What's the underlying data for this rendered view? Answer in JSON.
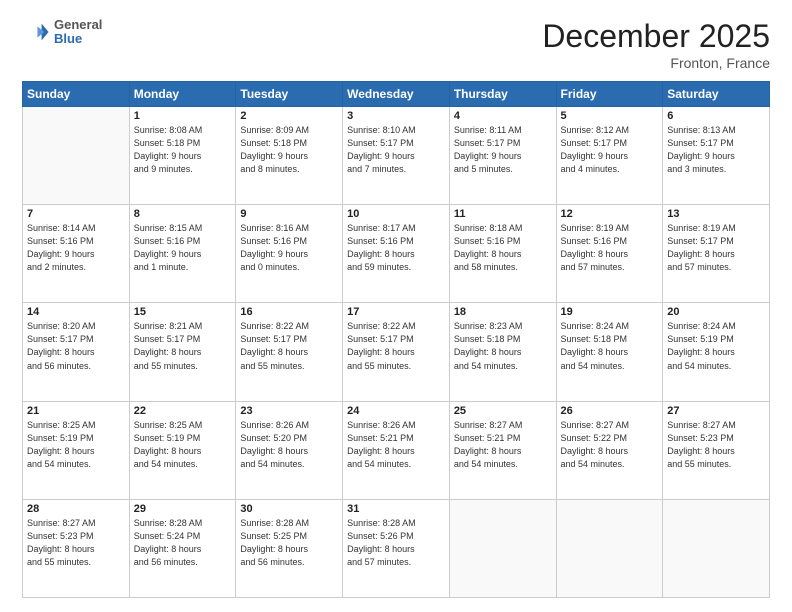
{
  "header": {
    "logo": {
      "general": "General",
      "blue": "Blue"
    },
    "title": "December 2025",
    "location": "Fronton, France"
  },
  "days_of_week": [
    "Sunday",
    "Monday",
    "Tuesday",
    "Wednesday",
    "Thursday",
    "Friday",
    "Saturday"
  ],
  "weeks": [
    [
      {
        "day": "",
        "info": ""
      },
      {
        "day": "1",
        "info": "Sunrise: 8:08 AM\nSunset: 5:18 PM\nDaylight: 9 hours\nand 9 minutes."
      },
      {
        "day": "2",
        "info": "Sunrise: 8:09 AM\nSunset: 5:18 PM\nDaylight: 9 hours\nand 8 minutes."
      },
      {
        "day": "3",
        "info": "Sunrise: 8:10 AM\nSunset: 5:17 PM\nDaylight: 9 hours\nand 7 minutes."
      },
      {
        "day": "4",
        "info": "Sunrise: 8:11 AM\nSunset: 5:17 PM\nDaylight: 9 hours\nand 5 minutes."
      },
      {
        "day": "5",
        "info": "Sunrise: 8:12 AM\nSunset: 5:17 PM\nDaylight: 9 hours\nand 4 minutes."
      },
      {
        "day": "6",
        "info": "Sunrise: 8:13 AM\nSunset: 5:17 PM\nDaylight: 9 hours\nand 3 minutes."
      }
    ],
    [
      {
        "day": "7",
        "info": "Sunrise: 8:14 AM\nSunset: 5:16 PM\nDaylight: 9 hours\nand 2 minutes."
      },
      {
        "day": "8",
        "info": "Sunrise: 8:15 AM\nSunset: 5:16 PM\nDaylight: 9 hours\nand 1 minute."
      },
      {
        "day": "9",
        "info": "Sunrise: 8:16 AM\nSunset: 5:16 PM\nDaylight: 9 hours\nand 0 minutes."
      },
      {
        "day": "10",
        "info": "Sunrise: 8:17 AM\nSunset: 5:16 PM\nDaylight: 8 hours\nand 59 minutes."
      },
      {
        "day": "11",
        "info": "Sunrise: 8:18 AM\nSunset: 5:16 PM\nDaylight: 8 hours\nand 58 minutes."
      },
      {
        "day": "12",
        "info": "Sunrise: 8:19 AM\nSunset: 5:16 PM\nDaylight: 8 hours\nand 57 minutes."
      },
      {
        "day": "13",
        "info": "Sunrise: 8:19 AM\nSunset: 5:17 PM\nDaylight: 8 hours\nand 57 minutes."
      }
    ],
    [
      {
        "day": "14",
        "info": "Sunrise: 8:20 AM\nSunset: 5:17 PM\nDaylight: 8 hours\nand 56 minutes."
      },
      {
        "day": "15",
        "info": "Sunrise: 8:21 AM\nSunset: 5:17 PM\nDaylight: 8 hours\nand 55 minutes."
      },
      {
        "day": "16",
        "info": "Sunrise: 8:22 AM\nSunset: 5:17 PM\nDaylight: 8 hours\nand 55 minutes."
      },
      {
        "day": "17",
        "info": "Sunrise: 8:22 AM\nSunset: 5:17 PM\nDaylight: 8 hours\nand 55 minutes."
      },
      {
        "day": "18",
        "info": "Sunrise: 8:23 AM\nSunset: 5:18 PM\nDaylight: 8 hours\nand 54 minutes."
      },
      {
        "day": "19",
        "info": "Sunrise: 8:24 AM\nSunset: 5:18 PM\nDaylight: 8 hours\nand 54 minutes."
      },
      {
        "day": "20",
        "info": "Sunrise: 8:24 AM\nSunset: 5:19 PM\nDaylight: 8 hours\nand 54 minutes."
      }
    ],
    [
      {
        "day": "21",
        "info": "Sunrise: 8:25 AM\nSunset: 5:19 PM\nDaylight: 8 hours\nand 54 minutes."
      },
      {
        "day": "22",
        "info": "Sunrise: 8:25 AM\nSunset: 5:19 PM\nDaylight: 8 hours\nand 54 minutes."
      },
      {
        "day": "23",
        "info": "Sunrise: 8:26 AM\nSunset: 5:20 PM\nDaylight: 8 hours\nand 54 minutes."
      },
      {
        "day": "24",
        "info": "Sunrise: 8:26 AM\nSunset: 5:21 PM\nDaylight: 8 hours\nand 54 minutes."
      },
      {
        "day": "25",
        "info": "Sunrise: 8:27 AM\nSunset: 5:21 PM\nDaylight: 8 hours\nand 54 minutes."
      },
      {
        "day": "26",
        "info": "Sunrise: 8:27 AM\nSunset: 5:22 PM\nDaylight: 8 hours\nand 54 minutes."
      },
      {
        "day": "27",
        "info": "Sunrise: 8:27 AM\nSunset: 5:23 PM\nDaylight: 8 hours\nand 55 minutes."
      }
    ],
    [
      {
        "day": "28",
        "info": "Sunrise: 8:27 AM\nSunset: 5:23 PM\nDaylight: 8 hours\nand 55 minutes."
      },
      {
        "day": "29",
        "info": "Sunrise: 8:28 AM\nSunset: 5:24 PM\nDaylight: 8 hours\nand 56 minutes."
      },
      {
        "day": "30",
        "info": "Sunrise: 8:28 AM\nSunset: 5:25 PM\nDaylight: 8 hours\nand 56 minutes."
      },
      {
        "day": "31",
        "info": "Sunrise: 8:28 AM\nSunset: 5:26 PM\nDaylight: 8 hours\nand 57 minutes."
      },
      {
        "day": "",
        "info": ""
      },
      {
        "day": "",
        "info": ""
      },
      {
        "day": "",
        "info": ""
      }
    ]
  ]
}
